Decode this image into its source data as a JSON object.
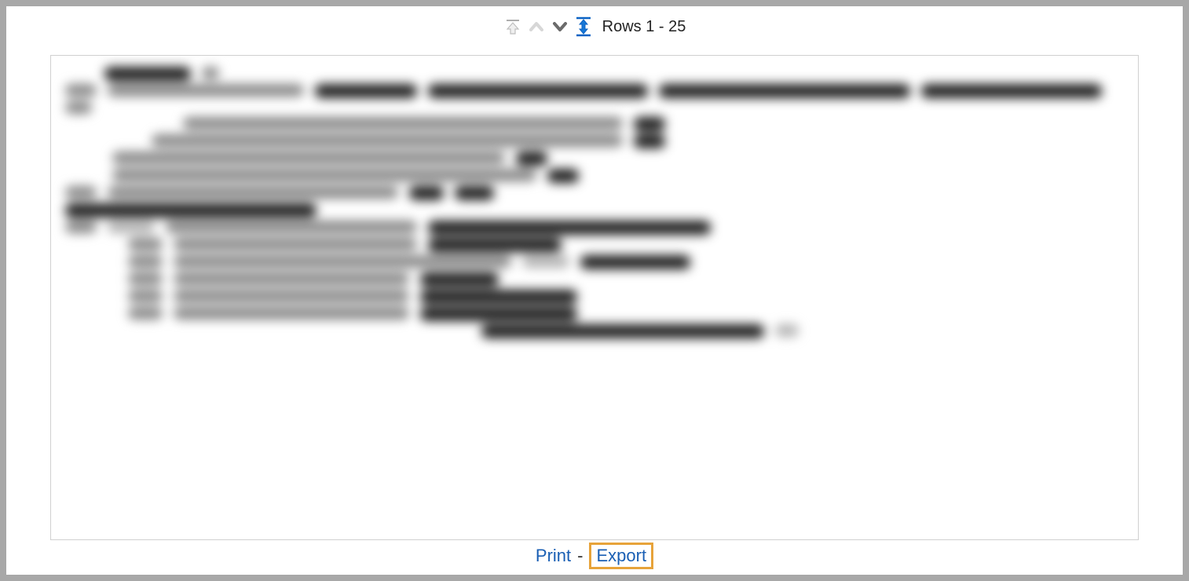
{
  "toolbar": {
    "rows_label": "Rows 1 - 25",
    "icons": {
      "scroll_top": "scroll-top-icon",
      "prev": "chevron-up-icon",
      "next": "chevron-down-icon",
      "expand": "expand-vertical-icon"
    }
  },
  "footer": {
    "print_label": "Print",
    "separator": "-",
    "export_label": "Export"
  }
}
